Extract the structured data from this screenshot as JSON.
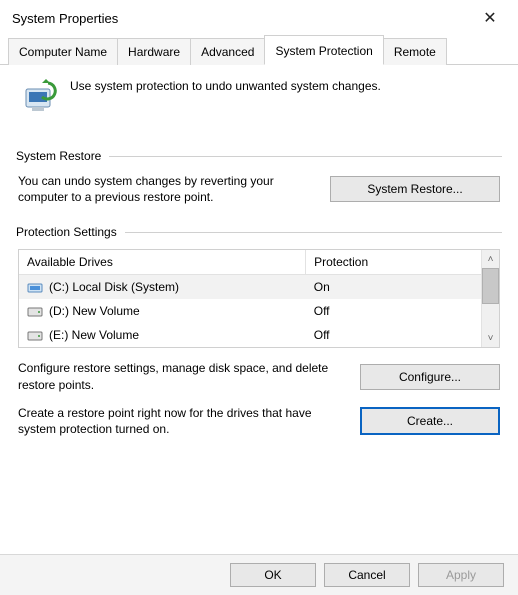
{
  "window": {
    "title": "System Properties"
  },
  "tabs": {
    "computer_name": "Computer Name",
    "hardware": "Hardware",
    "advanced": "Advanced",
    "system_protection": "System Protection",
    "remote": "Remote"
  },
  "intro_text": "Use system protection to undo unwanted system changes.",
  "system_restore": {
    "group_label": "System Restore",
    "desc": "You can undo system changes by reverting your computer to a previous restore point.",
    "button": "System Restore..."
  },
  "protection_settings": {
    "group_label": "Protection Settings",
    "col_drive": "Available Drives",
    "col_prot": "Protection",
    "drives": [
      {
        "label": "(C:) Local Disk (System)",
        "protection": "On",
        "icon": "system"
      },
      {
        "label": "(D:) New Volume",
        "protection": "Off",
        "icon": "drive"
      },
      {
        "label": "(E:) New Volume",
        "protection": "Off",
        "icon": "drive"
      }
    ],
    "configure_desc": "Configure restore settings, manage disk space, and delete restore points.",
    "configure_btn": "Configure...",
    "create_desc": "Create a restore point right now for the drives that have system protection turned on.",
    "create_btn": "Create..."
  },
  "dialog": {
    "ok": "OK",
    "cancel": "Cancel",
    "apply": "Apply"
  }
}
